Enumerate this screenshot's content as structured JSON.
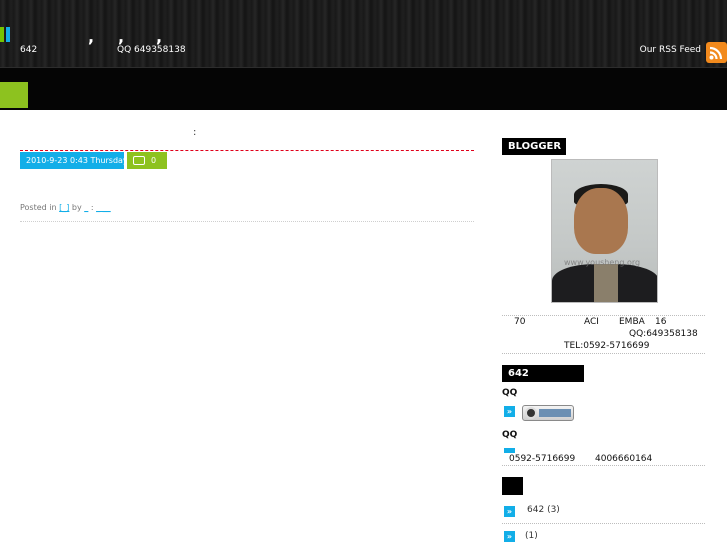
{
  "header": {
    "commas": [
      ",",
      ",",
      ","
    ],
    "subtitle_left": "642",
    "subtitle_qq": "QQ 649358138",
    "rss_label": "Our RSS Feed",
    "rss_icon": "rss-icon",
    "accent_green": "#8dc21f",
    "accent_blue": "#12aee8"
  },
  "post": {
    "title_colon": ":",
    "date": "2010-9-23 0:43 Thursday",
    "comment_icon": "comment-icon",
    "comment_count": "0",
    "posted_in_prefix": "Posted in",
    "category_link": "[_]",
    "by_label": "by",
    "author_link": "_",
    "author_sep": ":",
    "author_link2": "_ __"
  },
  "sidebar": {
    "blogger": {
      "title": "BLOGGER",
      "photo_watermark": "www.yousheng.org",
      "bio_line1_a": "70",
      "bio_line1_b": "ACI",
      "bio_line1_c": "EMBA",
      "bio_line1_d": "16",
      "bio_line2": "QQ:649358138",
      "bio_line3": "TEL:0592-5716699"
    },
    "contact": {
      "title": "642",
      "qq_label_1": "QQ",
      "qq_label_2": "QQ",
      "arrow": "»",
      "phone": "0592-5716699",
      "hotline": "4006660164"
    },
    "categories": {
      "title": "",
      "items": [
        {
          "arrow": "»",
          "label": "642",
          "count": "(3)"
        },
        {
          "arrow": "»",
          "label": "",
          "count": "(1)"
        }
      ]
    }
  }
}
